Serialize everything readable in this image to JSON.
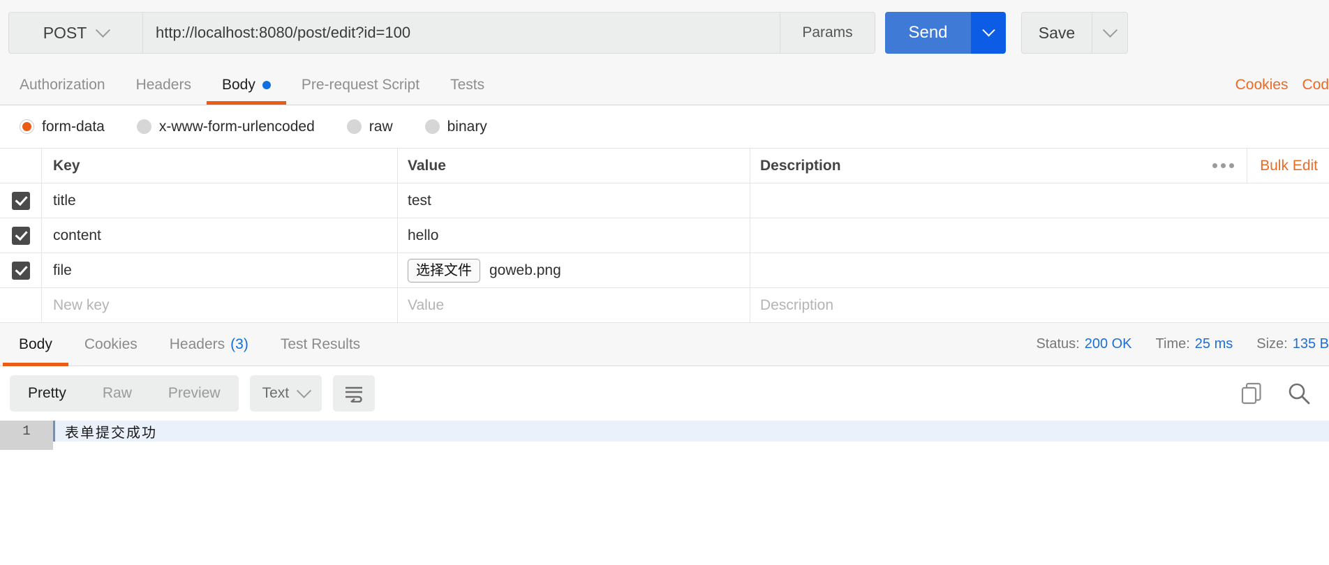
{
  "request_bar": {
    "method": "POST",
    "url": "http://localhost:8080/post/edit?id=100",
    "params_label": "Params",
    "send_label": "Send",
    "save_label": "Save"
  },
  "request_tabs": {
    "items": [
      {
        "label": "Authorization",
        "active": false,
        "dot": false
      },
      {
        "label": "Headers",
        "active": false,
        "dot": false
      },
      {
        "label": "Body",
        "active": true,
        "dot": true
      },
      {
        "label": "Pre-request Script",
        "active": false,
        "dot": false
      },
      {
        "label": "Tests",
        "active": false,
        "dot": false
      }
    ],
    "right_links": [
      "Cookies",
      "Cod"
    ]
  },
  "body_type": {
    "options": [
      {
        "label": "form-data",
        "selected": true
      },
      {
        "label": "x-www-form-urlencoded",
        "selected": false
      },
      {
        "label": "raw",
        "selected": false
      },
      {
        "label": "binary",
        "selected": false
      }
    ]
  },
  "kv_table": {
    "headers": {
      "key": "Key",
      "value": "Value",
      "description": "Description",
      "bulk_edit": "Bulk Edit"
    },
    "rows": [
      {
        "checked": true,
        "key": "title",
        "value": "test",
        "description": "",
        "is_file": false
      },
      {
        "checked": true,
        "key": "content",
        "value": "hello",
        "description": "",
        "is_file": false
      },
      {
        "checked": true,
        "key": "file",
        "value": "goweb.png",
        "description": "",
        "is_file": true,
        "file_button": "选择文件"
      }
    ],
    "new_row": {
      "key_placeholder": "New key",
      "value_placeholder": "Value",
      "description_placeholder": "Description"
    }
  },
  "response_tabs": {
    "items": [
      {
        "label": "Body",
        "active": true,
        "count": ""
      },
      {
        "label": "Cookies",
        "active": false,
        "count": ""
      },
      {
        "label": "Headers",
        "active": false,
        "count": "(3)"
      },
      {
        "label": "Test Results",
        "active": false,
        "count": ""
      }
    ],
    "meta": [
      {
        "label": "Status:",
        "value": "200 OK"
      },
      {
        "label": "Time:",
        "value": "25 ms"
      },
      {
        "label": "Size:",
        "value": "135 B"
      }
    ]
  },
  "response_toolbar": {
    "view_modes": [
      {
        "label": "Pretty",
        "active": true
      },
      {
        "label": "Raw",
        "active": false
      },
      {
        "label": "Preview",
        "active": false
      }
    ],
    "format": "Text"
  },
  "response_body": {
    "line_number": "1",
    "content": "表单提交成功"
  },
  "colors": {
    "accent_orange": "#ea5b15",
    "link_orange": "#ea6a26",
    "send_blue": "#3f7ad6",
    "send_caret_blue": "#0c5ce5",
    "status_blue": "#1d6fd8",
    "dot_blue": "#1070e0"
  }
}
